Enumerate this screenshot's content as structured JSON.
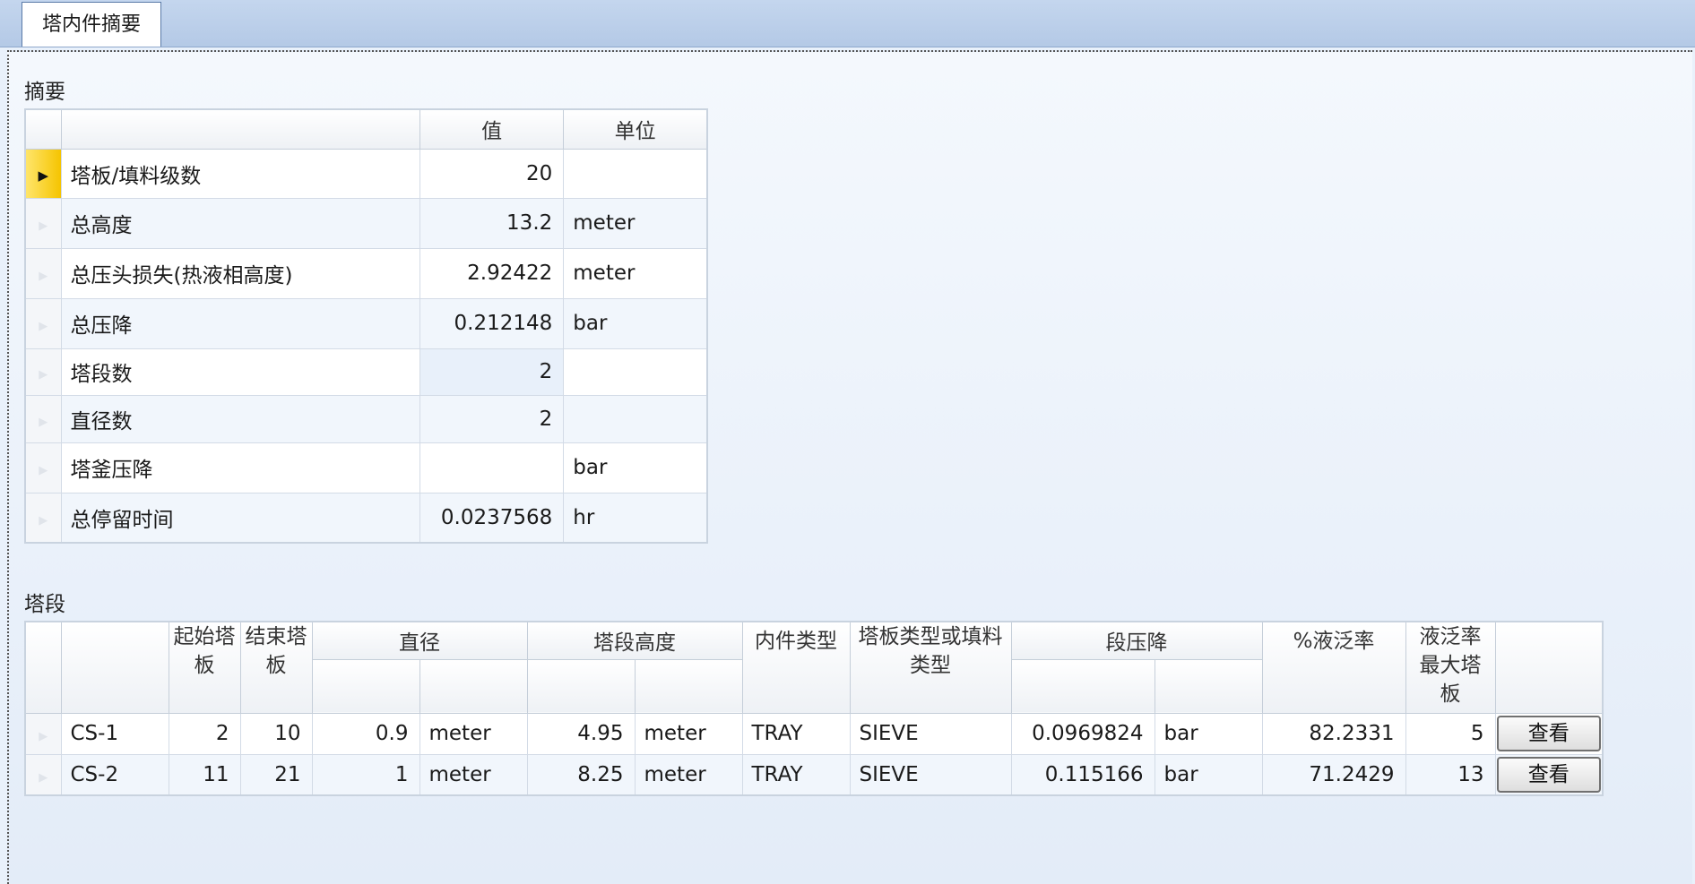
{
  "tabs": [
    {
      "label": "塔内件摘要"
    }
  ],
  "summary": {
    "title": "摘要",
    "columns": {
      "value": "值",
      "unit": "单位"
    },
    "rows": [
      {
        "label": "塔板/填料级数",
        "value": "20",
        "unit": ""
      },
      {
        "label": "总高度",
        "value": "13.2",
        "unit": "meter"
      },
      {
        "label": "总压头损失(热液相高度)",
        "value": "2.92422",
        "unit": "meter"
      },
      {
        "label": "总压降",
        "value": "0.212148",
        "unit": "bar"
      },
      {
        "label": "塔段数",
        "value": "2",
        "unit": ""
      },
      {
        "label": "直径数",
        "value": "2",
        "unit": ""
      },
      {
        "label": "塔釜压降",
        "value": "",
        "unit": "bar"
      },
      {
        "label": "总停留时间",
        "value": "0.0237568",
        "unit": "hr"
      }
    ]
  },
  "sections": {
    "title": "塔段",
    "columns": {
      "start_tray": "起始塔\n板",
      "end_tray": "结束塔\n板",
      "diameter": "直径",
      "height": "塔段高度",
      "internal_type": "内件类型",
      "tray_packing_type": "塔板类型或填料\n类型",
      "pressure_drop": "段压降",
      "flood_pct": "%液泛率",
      "max_flood_tray": "液泛率\n最大塔\n板"
    },
    "rows": [
      {
        "name": "CS-1",
        "start": "2",
        "end": "10",
        "diameter": "0.9",
        "diameter_unit": "meter",
        "height": "4.95",
        "height_unit": "meter",
        "internal": "TRAY",
        "tray_type": "SIEVE",
        "dp": "0.0969824",
        "dp_unit": "bar",
        "flood": "82.2331",
        "max_tray": "5",
        "button": "查看"
      },
      {
        "name": "CS-2",
        "start": "11",
        "end": "21",
        "diameter": "1",
        "diameter_unit": "meter",
        "height": "8.25",
        "height_unit": "meter",
        "internal": "TRAY",
        "tray_type": "SIEVE",
        "dp": "0.115166",
        "dp_unit": "bar",
        "flood": "71.2429",
        "max_tray": "13",
        "button": "查看"
      }
    ]
  }
}
